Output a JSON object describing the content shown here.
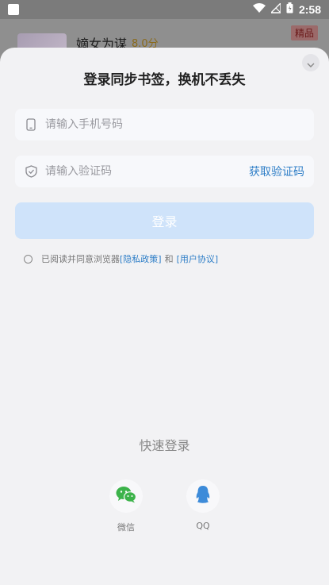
{
  "status_bar": {
    "time": "2:58"
  },
  "background": {
    "title": "嫡女为谋",
    "score": "8.0分",
    "badge": "精品"
  },
  "sheet": {
    "title": "登录同步书签，换机不丢失",
    "phone": {
      "placeholder": "请输入手机号码",
      "value": ""
    },
    "code": {
      "placeholder": "请输入验证码",
      "value": "",
      "get_code_label": "获取验证码"
    },
    "login_label": "登录",
    "agreement": {
      "prefix": "已阅读并同意浏览器",
      "privacy": "[隐私政策]",
      "and": "和",
      "terms": "[用户协议]"
    },
    "quick_login": {
      "title": "快速登录",
      "options": [
        {
          "label": "微信",
          "icon": "wechat-icon",
          "color": "#3cb34a"
        },
        {
          "label": "QQ",
          "icon": "qq-icon",
          "color": "#3d8bd9"
        }
      ]
    }
  },
  "colors": {
    "accent": "#2e7ec7",
    "login_disabled": "#cfe3fa"
  }
}
